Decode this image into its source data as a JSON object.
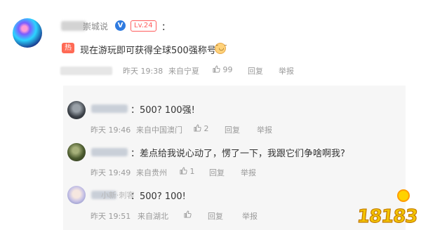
{
  "main_comment": {
    "name_suffix": "崇城说",
    "vip_badge": "V",
    "level": "Lv.24",
    "colon": "：",
    "hot_tag": "热",
    "text": "现在游玩即可获得全球500强称号",
    "emoji_face": "˘◡˘",
    "time": "昨天 19:38",
    "location": "来自宁夏",
    "like_count": "99",
    "reply_label": "回复",
    "report_label": "举报"
  },
  "replies": [
    {
      "text": "：500? 100强!",
      "time": "昨天 19:46",
      "location": "来自中国澳门",
      "like_count": "2",
      "reply_label": "回复",
      "report_label": "举报"
    },
    {
      "text": "：差点给我说心动了，愣了一下，我跟它们争啥啊我?",
      "time": "昨天 19:49",
      "location": "来自贵州",
      "like_count": "1",
      "reply_label": "回复",
      "report_label": "举报"
    },
    {
      "name_suffix": "小新·刺客",
      "text": "：500? 100!",
      "time": "昨天 19:51",
      "location": "来自湖北",
      "like_count": "",
      "reply_label": "回复",
      "report_label": "举报"
    }
  ],
  "icons": {
    "like": "thumbs-up-icon",
    "vip": "verified-badge-icon"
  },
  "watermark": {
    "text": "18183"
  },
  "colors": {
    "hot": "#ff6a55",
    "level": "#ff5c5c",
    "vip": "#2f7be0",
    "logo_yellow": "#f3c400"
  }
}
